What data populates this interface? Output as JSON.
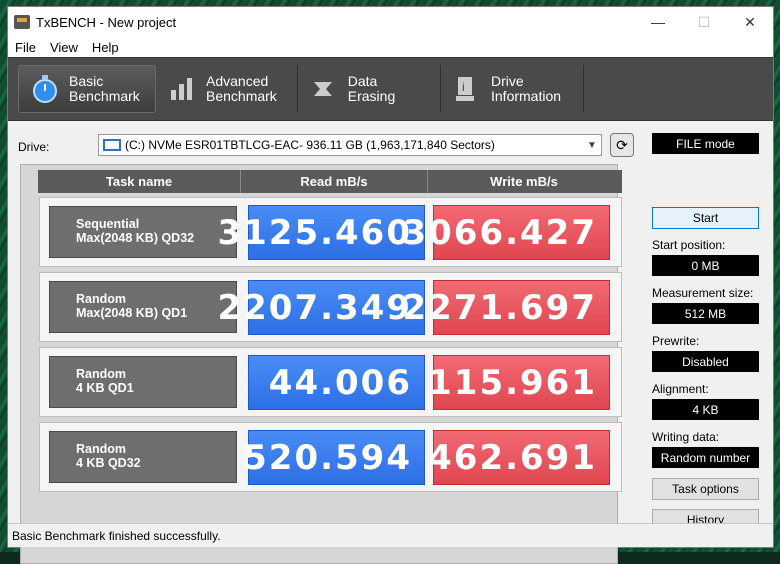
{
  "window": {
    "title": "TxBENCH - New project",
    "minimize": "—",
    "maximize": "☐",
    "close": "✕"
  },
  "menu": [
    "File",
    "View",
    "Help"
  ],
  "tabs": [
    {
      "label1": "Basic",
      "label2": "Benchmark",
      "icon": "stopwatch-icon"
    },
    {
      "label1": "Advanced",
      "label2": "Benchmark",
      "icon": "bar-chart-icon"
    },
    {
      "label1": "Data Erasing",
      "label2": "",
      "icon": "eraser-icon"
    },
    {
      "label1": "Drive",
      "label2": "Information",
      "icon": "drive-info-icon"
    }
  ],
  "drive": {
    "label": "Drive:",
    "selected": "(C:) NVMe ESR01TBTLCG-EAC-  936.11 GB (1,963,171,840 Sectors)",
    "mode": "FILE mode"
  },
  "table": {
    "headers": [
      "Task name",
      "Read mB/s",
      "Write mB/s"
    ],
    "rows": [
      {
        "line1": "Sequential",
        "line2": "Max(2048 KB) QD32",
        "read": "3125.460",
        "write": "3066.427"
      },
      {
        "line1": "Random",
        "line2": "Max(2048 KB) QD1",
        "read": "2207.349",
        "write": "2271.697"
      },
      {
        "line1": "Random",
        "line2": "4 KB QD1",
        "read": "44.006",
        "write": "115.961"
      },
      {
        "line1": "Random",
        "line2": "4 KB QD32",
        "read": "520.594",
        "write": "462.691"
      }
    ]
  },
  "side": {
    "start": "Start",
    "start_position_label": "Start position:",
    "start_position": "0 MB",
    "measurement_size_label": "Measurement size:",
    "measurement_size": "512 MB",
    "prewrite_label": "Prewrite:",
    "prewrite": "Disabled",
    "alignment_label": "Alignment:",
    "alignment": "4 KB",
    "writing_data_label": "Writing data:",
    "writing_data": "Random number",
    "task_options": "Task options",
    "history": "History"
  },
  "status": "Basic Benchmark finished successfully."
}
